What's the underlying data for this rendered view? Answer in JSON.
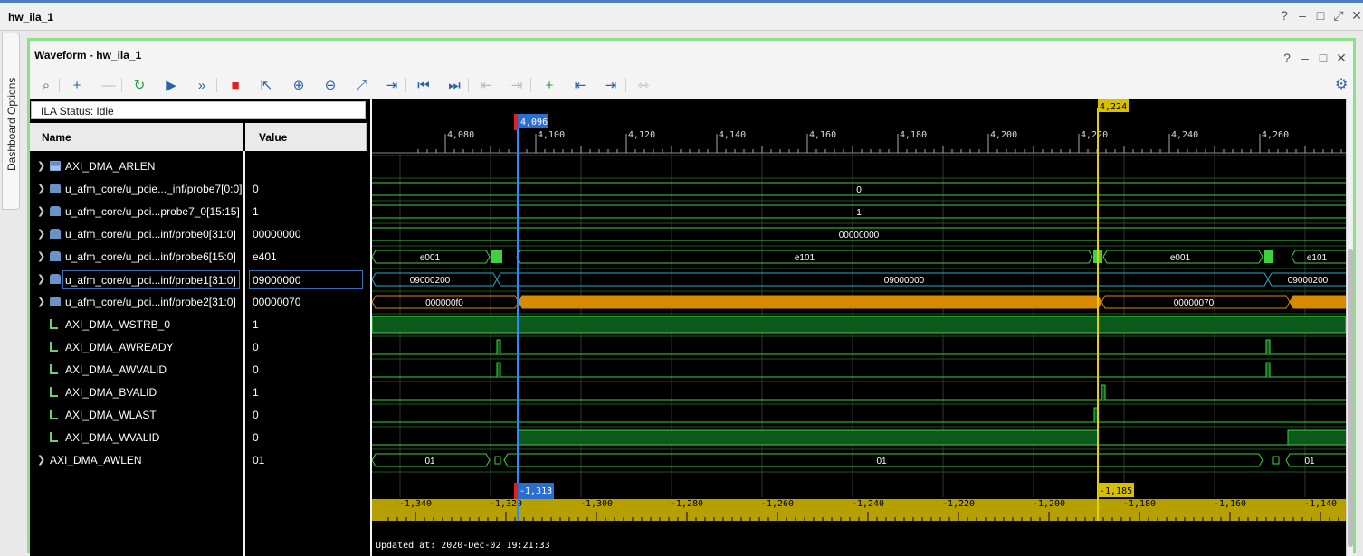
{
  "window": {
    "title": "hw_ila_1",
    "controls": [
      "?",
      "–",
      "□",
      "⤢",
      "✕"
    ]
  },
  "side_tab": {
    "label": "Dashboard Options"
  },
  "panel": {
    "title": "Waveform - hw_ila_1",
    "controls": [
      "?",
      "–",
      "□",
      "✕"
    ]
  },
  "toolbar": {
    "buttons": [
      {
        "name": "search",
        "glyph": "⌕",
        "enabled": true
      },
      {
        "name": "add",
        "glyph": "+",
        "enabled": true
      },
      {
        "name": "remove",
        "glyph": "—",
        "enabled": false
      },
      {
        "name": "run-trigger-immediate",
        "glyph": "↻",
        "enabled": true
      },
      {
        "name": "run-trigger",
        "glyph": "▶",
        "enabled": true
      },
      {
        "name": "run-continuous",
        "glyph": "»",
        "enabled": true
      },
      {
        "name": "stop",
        "glyph": "■",
        "enabled": true
      },
      {
        "name": "export",
        "glyph": "⇱",
        "enabled": true
      },
      {
        "name": "zoom-in",
        "glyph": "⊕",
        "enabled": true
      },
      {
        "name": "zoom-out",
        "glyph": "⊖",
        "enabled": true
      },
      {
        "name": "zoom-fit",
        "glyph": "⤢",
        "enabled": true
      },
      {
        "name": "go-to-cursor",
        "glyph": "⇥",
        "enabled": true
      },
      {
        "name": "go-to-start",
        "glyph": "⏮",
        "enabled": true
      },
      {
        "name": "go-to-end",
        "glyph": "⏭",
        "enabled": true
      },
      {
        "name": "previous-transition",
        "glyph": "⇤",
        "enabled": false
      },
      {
        "name": "next-transition",
        "glyph": "⇥",
        "enabled": false
      },
      {
        "name": "add-marker",
        "glyph": "+",
        "enabled": true
      },
      {
        "name": "previous-marker",
        "glyph": "⇤",
        "enabled": true
      },
      {
        "name": "next-marker",
        "glyph": "⇥",
        "enabled": true
      },
      {
        "name": "swap-cursors",
        "glyph": "⇿",
        "enabled": false
      }
    ]
  },
  "status": "ILA Status:  Idle",
  "columns": {
    "name": "Name",
    "value": "Value"
  },
  "signals": [
    {
      "name": "AXI_DMA_ARLEN",
      "value": "",
      "icon": "bus",
      "expandable": true
    },
    {
      "name": "u_afm_core/u_pcie..._inf/probe7[0:0]",
      "value": "0",
      "icon": "probe",
      "expandable": true
    },
    {
      "name": "u_afm_core/u_pci...probe7_0[15:15]",
      "value": "1",
      "icon": "probe",
      "expandable": true
    },
    {
      "name": "u_afm_core/u_pci...inf/probe0[31:0]",
      "value": "00000000",
      "icon": "probe",
      "expandable": true
    },
    {
      "name": "u_afm_core/u_pci...inf/probe6[15:0]",
      "value": "e401",
      "icon": "probe",
      "expandable": true
    },
    {
      "name": "u_afm_core/u_pci...inf/probe1[31:0]",
      "value": "09000000",
      "icon": "probe",
      "expandable": true,
      "selected": true
    },
    {
      "name": "u_afm_core/u_pci...inf/probe2[31:0]",
      "value": "00000070",
      "icon": "probe",
      "expandable": true
    },
    {
      "name": "AXI_DMA_WSTRB_0",
      "value": "1",
      "icon": "bit",
      "expandable": false
    },
    {
      "name": "AXI_DMA_AWREADY",
      "value": "0",
      "icon": "bit",
      "expandable": false
    },
    {
      "name": "AXI_DMA_AWVALID",
      "value": "0",
      "icon": "bit",
      "expandable": false
    },
    {
      "name": "AXI_DMA_BVALID",
      "value": "1",
      "icon": "bit",
      "expandable": false
    },
    {
      "name": "AXI_DMA_WLAST",
      "value": "0",
      "icon": "bit",
      "expandable": false
    },
    {
      "name": "AXI_DMA_WVALID",
      "value": "0",
      "icon": "bit",
      "expandable": false
    },
    {
      "name": "AXI_DMA_AWLEN",
      "value": "01",
      "icon": "none",
      "expandable": true
    }
  ],
  "timeline": {
    "ticks_top": [
      "4,080",
      "4,100",
      "4,120",
      "4,140",
      "4,160",
      "4,180",
      "4,200",
      "4,220",
      "4,240",
      "4,260"
    ],
    "ticks_bottom": [
      "-1,340",
      "-1,320",
      "-1,300",
      "-1,280",
      "-1,260",
      "-1,240",
      "-1,220",
      "-1,200",
      "-1,180",
      "-1,160",
      "-1,140"
    ],
    "cursor_blue": {
      "top": "4,096",
      "bottom": "-1,313"
    },
    "cursor_yellow": {
      "top": "4,224",
      "bottom": "-1,185"
    },
    "bus_labels": {
      "probe0": "00000000",
      "probe7_0": "0",
      "probe7_15": "1",
      "probe6": [
        "e001",
        "e101",
        "e001",
        "e101"
      ],
      "probe1": [
        "09000200",
        "09000000",
        "09000200"
      ],
      "probe2": [
        "000000f0",
        "00000070"
      ],
      "awlen": [
        "01",
        "01",
        "01"
      ]
    },
    "colors": {
      "bus": "#3fd13f",
      "highlight": "#d98a00",
      "ruler": "#b5a000",
      "cursor_blue": "#2a8cff",
      "cursor_yellow": "#e8d000"
    }
  },
  "updated": "Updated at: 2020-Dec-02 19:21:33"
}
